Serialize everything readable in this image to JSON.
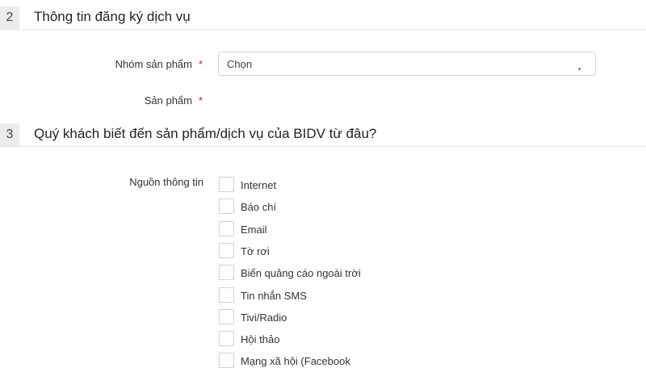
{
  "section2": {
    "number": "2",
    "title": "Thông tin đăng ký dịch vụ"
  },
  "product_group": {
    "label": "Nhóm sản phẩm",
    "required": "*",
    "value": "Chọn"
  },
  "product": {
    "label": "Sản phẩm",
    "required": "*"
  },
  "section3": {
    "number": "3",
    "title": "Quý khách biết đến sản phẩm/dịch vụ của BIDV từ đâu?"
  },
  "source": {
    "label": "Nguồn thông tin",
    "options": [
      "Internet",
      "Báo chí",
      "Email",
      "Tờ rơi",
      "Biển quảng cáo ngoài trời",
      "Tin nhắn SMS",
      "Tivi/Radio",
      "Hội thảo",
      "Mạng xã hội (Facebook"
    ]
  }
}
